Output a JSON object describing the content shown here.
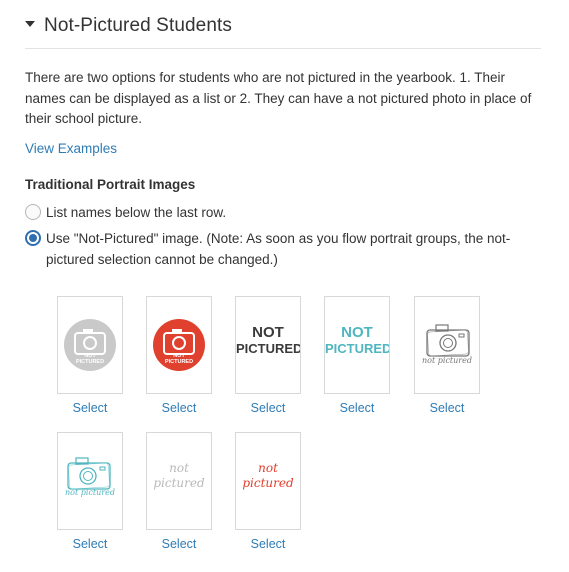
{
  "section_title": "Not-Pictured Students",
  "description": "There are two options for students who are not pictured in the yearbook. 1. Their names can be displayed as a list or 2. They can have a not pictured photo in place of their school picture.",
  "view_examples_label": "View Examples",
  "traditional_label": "Traditional Portrait Images",
  "radio_options": [
    {
      "label": "List names below the last row.",
      "checked": false
    },
    {
      "label": "Use \"Not-Pictured\" image. (Note: As soon as you flow portrait groups, the not-pictured selection cannot be changed.)",
      "checked": true
    }
  ],
  "image_options": [
    {
      "style": "gray-circle-camera",
      "line1": "NOT",
      "line2": "PICTURED",
      "select_label": "Select",
      "color": "#c9c9c9"
    },
    {
      "style": "red-circle-camera",
      "line1": "NOT",
      "line2": "PICTURED",
      "select_label": "Select",
      "color": "#e0412f"
    },
    {
      "style": "text-dark",
      "line1": "NOT",
      "line2": "PICTURED",
      "select_label": "Select",
      "color": "#3a3a3a"
    },
    {
      "style": "text-teal",
      "line1": "NOT",
      "line2": "PICTURED",
      "select_label": "Select",
      "color": "#4fb6bf"
    },
    {
      "style": "sketch-camera-gray",
      "line1": "not pictured",
      "line2": "",
      "select_label": "Select",
      "color": "#777777"
    },
    {
      "style": "sketch-camera-teal",
      "line1": "not pictured",
      "line2": "",
      "select_label": "Select",
      "color": "#4fb6bf"
    },
    {
      "style": "script-gray",
      "line1": "not",
      "line2": "pictured",
      "select_label": "Select",
      "color": "#b9b9b9"
    },
    {
      "style": "script-red",
      "line1": "not",
      "line2": "pictured",
      "select_label": "Select",
      "color": "#e0412f"
    }
  ]
}
